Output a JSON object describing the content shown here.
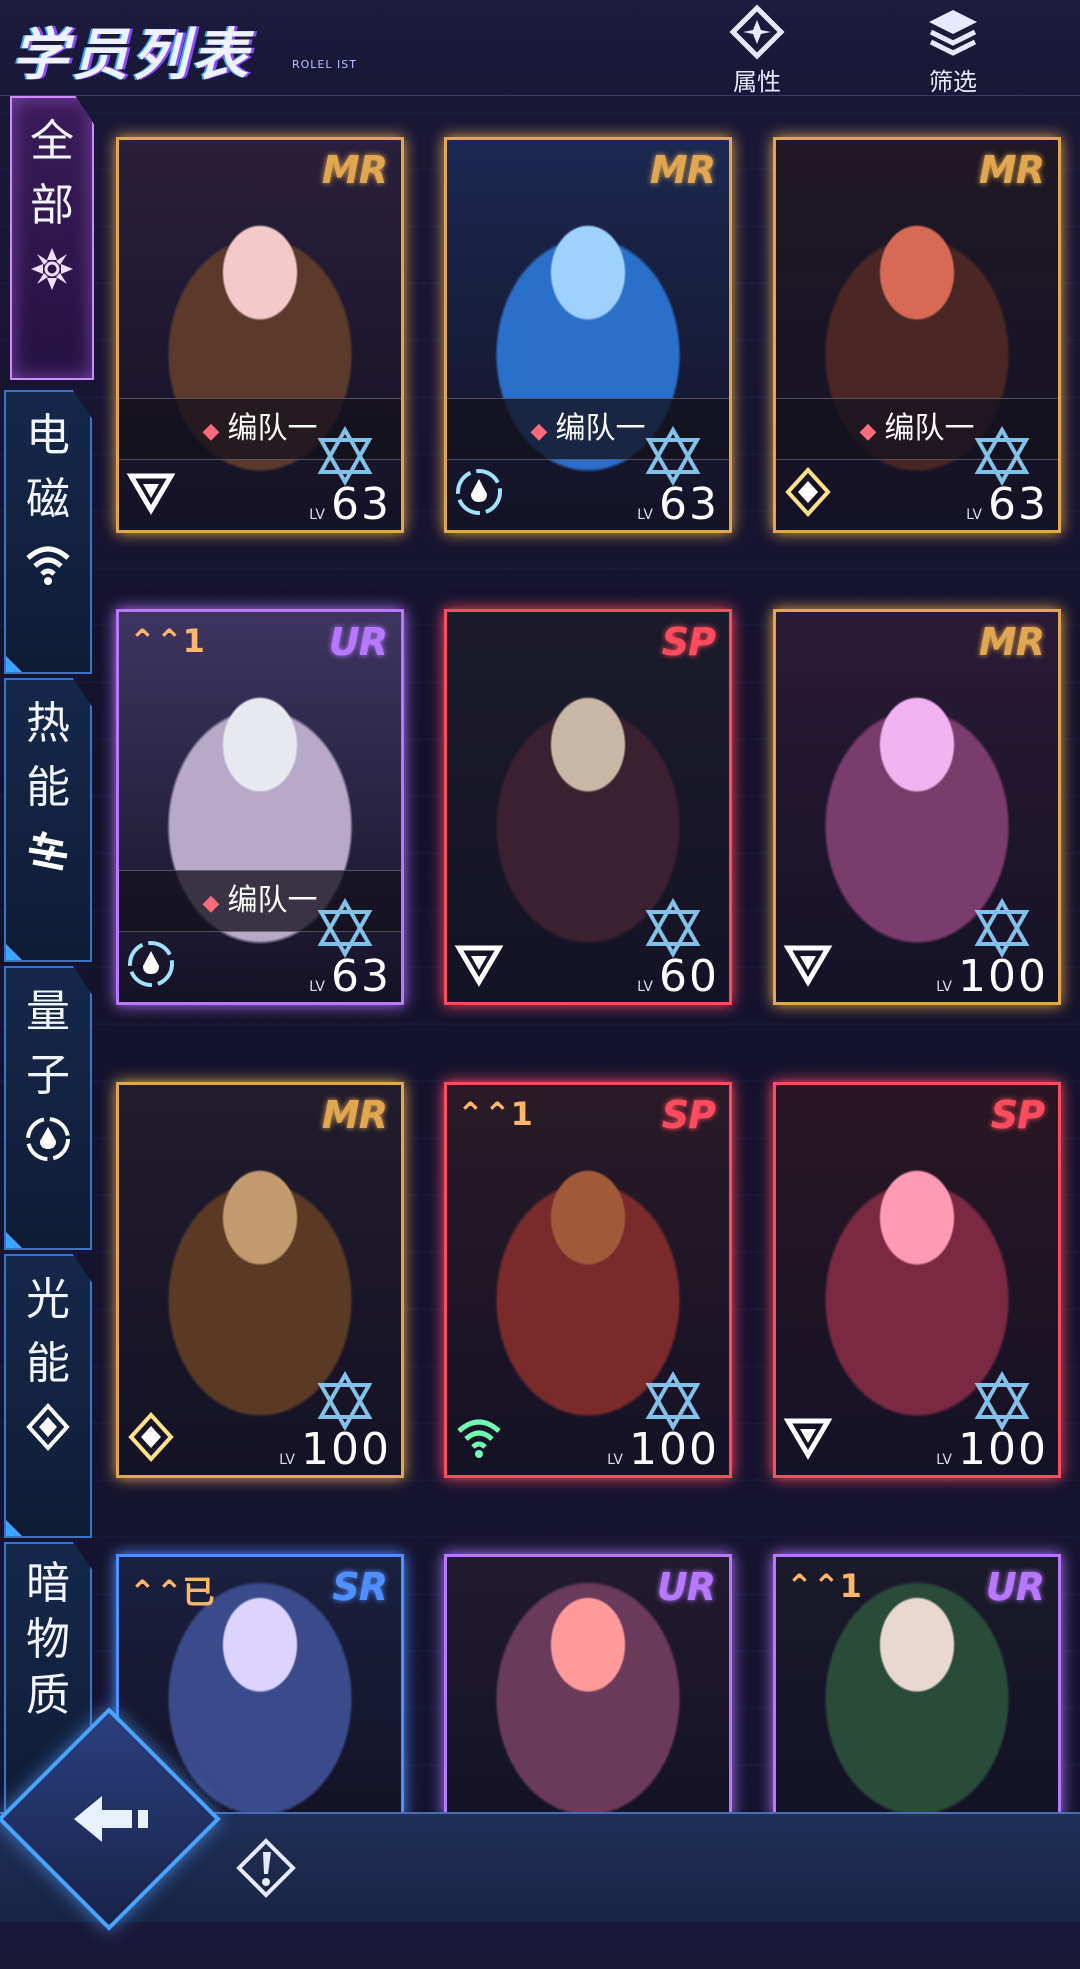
{
  "header": {
    "title": "学员列表",
    "subtitle": "ROLEL IST",
    "attributes_label": "属性",
    "filter_label": "筛选"
  },
  "sidebar": {
    "tabs": [
      {
        "chars": [
          "全",
          "部"
        ],
        "icon": "aperture-icon",
        "active": true
      },
      {
        "chars": [
          "电",
          "磁"
        ],
        "icon": "wifi-icon",
        "active": false
      },
      {
        "chars": [
          "热",
          "能"
        ],
        "icon": "heat-waves-icon",
        "active": false
      },
      {
        "chars": [
          "量",
          "子"
        ],
        "icon": "quantum-drop-icon",
        "active": false
      },
      {
        "chars": [
          "光",
          "能"
        ],
        "icon": "light-diamond-icon",
        "active": false
      },
      {
        "chars": [
          "暗",
          "物",
          "质"
        ],
        "icon": "dark-triangle-icon",
        "active": false
      }
    ]
  },
  "lv_label": "LV",
  "team_label": "编队一",
  "cards": [
    {
      "rarity": "MR",
      "level": "63",
      "team": true,
      "element": "dark-triangle-icon",
      "ascend": "",
      "frame": "#e0a650"
    },
    {
      "rarity": "MR",
      "level": "63",
      "team": true,
      "element": "quantum-drop-icon",
      "ascend": "",
      "frame": "#e0a650"
    },
    {
      "rarity": "MR",
      "level": "63",
      "team": true,
      "element": "light-diamond-icon",
      "ascend": "",
      "frame": "#e0a650"
    },
    {
      "rarity": "UR",
      "level": "63",
      "team": true,
      "element": "quantum-drop-icon",
      "ascend": "1",
      "frame": "#b877ff"
    },
    {
      "rarity": "SP",
      "level": "60",
      "team": false,
      "element": "dark-triangle-icon",
      "ascend": "",
      "frame": "#ff4b5e"
    },
    {
      "rarity": "MR",
      "level": "100",
      "team": false,
      "element": "dark-triangle-icon",
      "ascend": "",
      "frame": "#e0a650"
    },
    {
      "rarity": "MR",
      "level": "100",
      "team": false,
      "element": "light-diamond-icon",
      "ascend": "",
      "frame": "#e0a650"
    },
    {
      "rarity": "SP",
      "level": "100",
      "team": false,
      "element": "wifi-icon",
      "ascend": "1",
      "frame": "#ff4b5e"
    },
    {
      "rarity": "SP",
      "level": "100",
      "team": false,
      "element": "dark-triangle-icon",
      "ascend": "",
      "frame": "#ff4b5e"
    },
    {
      "rarity": "SR",
      "level": "",
      "team": false,
      "element": "",
      "ascend": "已",
      "frame": "#4f8fff"
    },
    {
      "rarity": "UR",
      "level": "",
      "team": false,
      "element": "",
      "ascend": "",
      "frame": "#b877ff"
    },
    {
      "rarity": "UR",
      "level": "",
      "team": false,
      "element": "",
      "ascend": "1",
      "frame": "#b877ff"
    }
  ],
  "colors": {
    "mr": "#e0a650",
    "ur": "#b877ff",
    "sp": "#ff4b5e",
    "sr": "#4f8fff",
    "accent": "#4aa4ff"
  },
  "bottom": {
    "back_icon": "back-arrow-icon",
    "info_icon": "info-exclamation-icon"
  }
}
